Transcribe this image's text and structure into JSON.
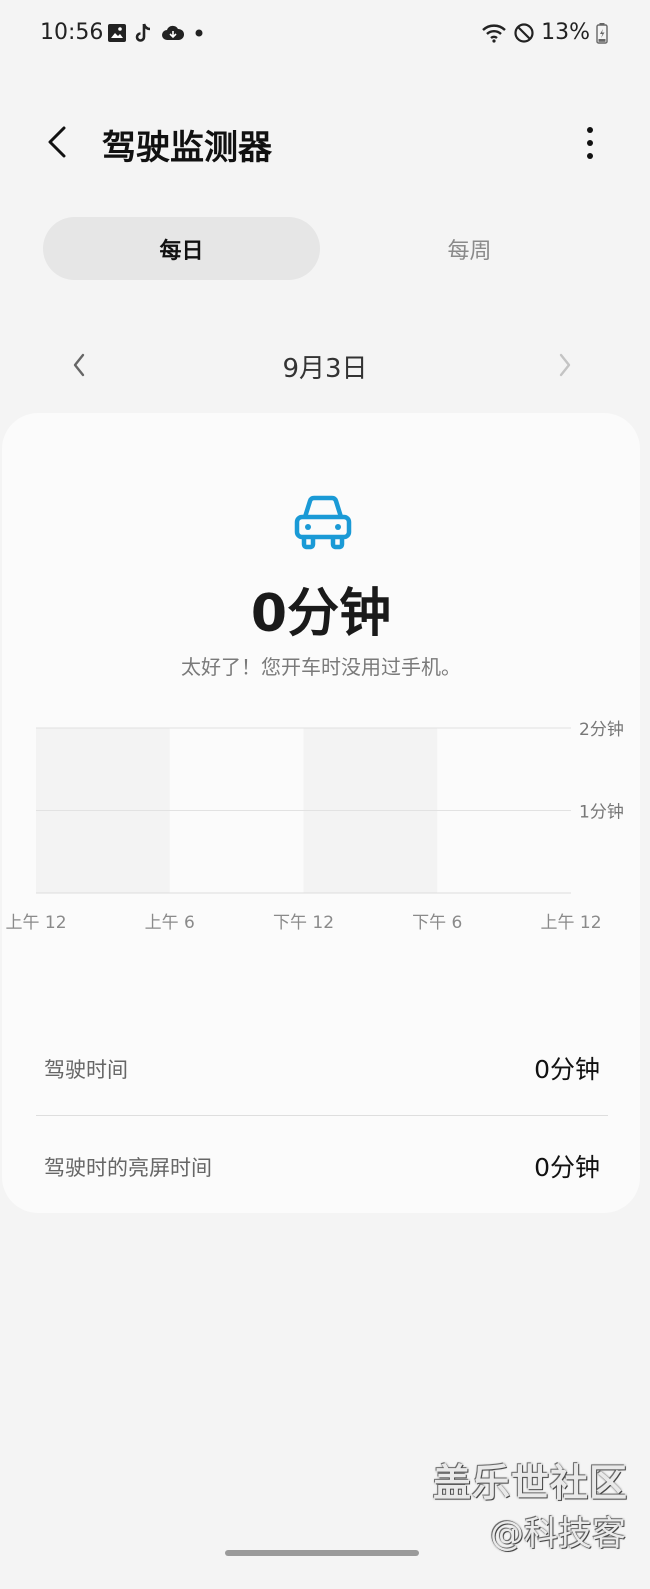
{
  "status_bar": {
    "time": "10:56",
    "battery": "13%",
    "notification_icons": [
      "gallery-icon",
      "tiktok-icon",
      "cloud-icon",
      "dot-icon"
    ],
    "system_icons": [
      "wifi-icon",
      "do-not-disturb-icon",
      "battery-icon"
    ]
  },
  "app_bar": {
    "title": "驾驶监测器"
  },
  "tabs": [
    {
      "label": "每日",
      "active": true
    },
    {
      "label": "每周",
      "active": false
    }
  ],
  "date_nav": {
    "date": "9月3日"
  },
  "summary": {
    "value": "0分钟",
    "message": "太好了！您开车时没用过手机。"
  },
  "chart_data": {
    "type": "bar",
    "x_tick_labels": [
      "上午 12",
      "上午 6",
      "下午 12",
      "下午 6",
      "上午 12"
    ],
    "y_tick_labels": [
      "1分钟",
      "2分钟"
    ],
    "ylim": [
      0,
      2
    ],
    "series": [
      {
        "values": [
          0,
          0,
          0,
          0
        ]
      }
    ],
    "grid": true
  },
  "details": [
    {
      "label": "驾驶时间",
      "value": "0分钟"
    },
    {
      "label": "驾驶时的亮屏时间",
      "value": "0分钟"
    }
  ],
  "watermark": {
    "line1": "盖乐世社区",
    "line2": "@科技客"
  },
  "colors": {
    "accent": "#1a9ad6",
    "background": "#f4f4f4",
    "card": "#fbfbfb"
  }
}
